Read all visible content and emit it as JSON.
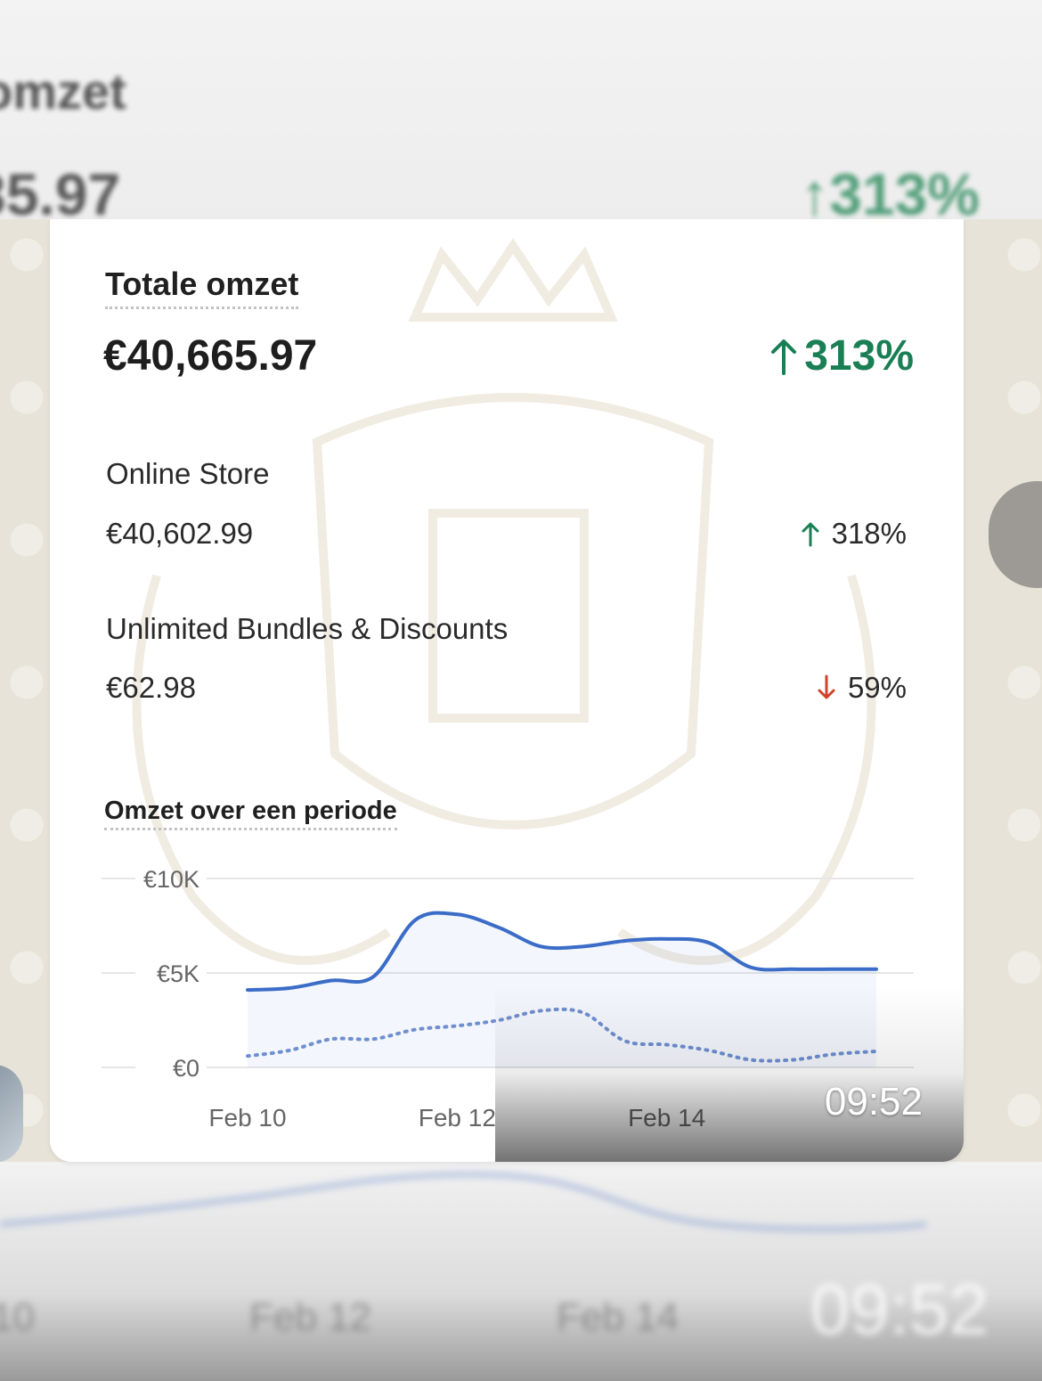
{
  "background": {
    "top_title": "omzet",
    "top_value": "35.97",
    "top_pct": "↑313%",
    "bottom_x_labels": [
      "10",
      "Feb 12",
      "Feb 14"
    ],
    "bottom_time": "09:52"
  },
  "card": {
    "title": "Totale omzet",
    "total_value": "€40,665.97",
    "total_change": "313%",
    "total_direction": "up",
    "rows": [
      {
        "label": "Online Store",
        "value": "€40,602.99",
        "change": "318%",
        "direction": "up"
      },
      {
        "label": "Unlimited Bundles & Discounts",
        "value": "€62.98",
        "change": "59%",
        "direction": "down"
      }
    ],
    "chart_title": "Omzet over een periode",
    "timestamp": "09:52"
  },
  "colors": {
    "up": "#1a7f55",
    "down": "#d0432a",
    "series_current": "#3b6cc7",
    "series_previous": "#6f8fd0"
  },
  "chart_data": {
    "type": "line",
    "title": "Omzet over een periode",
    "y_tick_labels": [
      "€10K",
      "€5K",
      "€0"
    ],
    "y_ticks": [
      10000,
      5000,
      0
    ],
    "ylim": [
      0,
      10000
    ],
    "x_tick_labels": [
      "Feb 10",
      "Feb 12",
      "Feb 14"
    ],
    "x_ticks": [
      10,
      12,
      14
    ],
    "xlim": [
      10,
      16
    ],
    "grid": true,
    "series": [
      {
        "style": "solid",
        "x": [
          10,
          10.4,
          10.8,
          11.2,
          11.6,
          12.0,
          12.4,
          12.8,
          13.2,
          13.6,
          14.0,
          14.4,
          14.8,
          15.2,
          15.6,
          16.0
        ],
        "values": [
          4100,
          4200,
          4600,
          4800,
          7800,
          8100,
          7400,
          6400,
          6400,
          6700,
          6800,
          6600,
          5300,
          5200,
          5200,
          5200
        ]
      },
      {
        "style": "dotted",
        "x": [
          10,
          10.4,
          10.8,
          11.2,
          11.6,
          12.0,
          12.4,
          12.8,
          13.2,
          13.6,
          14.0,
          14.4,
          14.8,
          15.2,
          15.6,
          16.0
        ],
        "values": [
          600,
          900,
          1500,
          1500,
          2000,
          2200,
          2500,
          3000,
          2900,
          1400,
          1200,
          900,
          400,
          400,
          700,
          850
        ]
      }
    ]
  }
}
